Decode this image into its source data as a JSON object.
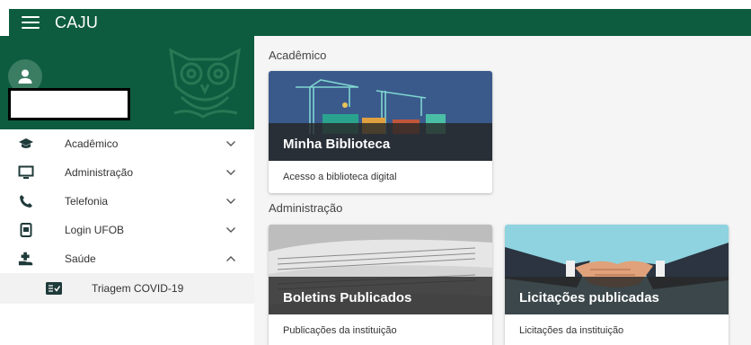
{
  "app": {
    "title": "CAJU"
  },
  "sidebar": {
    "items": [
      {
        "label": "Acadêmico",
        "icon": "graduation-cap-icon",
        "expanded": false
      },
      {
        "label": "Administração",
        "icon": "monitor-icon",
        "expanded": false
      },
      {
        "label": "Telefonia",
        "icon": "phone-icon",
        "expanded": false
      },
      {
        "label": "Login UFOB",
        "icon": "tablet-icon",
        "expanded": false
      },
      {
        "label": "Saúde",
        "icon": "hand-plus-icon",
        "expanded": true
      }
    ],
    "subitems": [
      {
        "label": "Triagem COVID-19",
        "icon": "checklist-icon"
      }
    ]
  },
  "main": {
    "sections": [
      {
        "title": "Acadêmico",
        "cards": [
          {
            "title": "Minha Biblioteca",
            "description": "Acesso a biblioteca digital"
          }
        ]
      },
      {
        "title": "Administração",
        "cards": [
          {
            "title": "Boletins Publicados",
            "description": "Publicações da instituição"
          },
          {
            "title": "Licitações publicadas",
            "description": "Licitações da instituição"
          }
        ]
      }
    ]
  },
  "colors": {
    "brand": "#0d5c3f",
    "background": "#f5f5f5"
  }
}
